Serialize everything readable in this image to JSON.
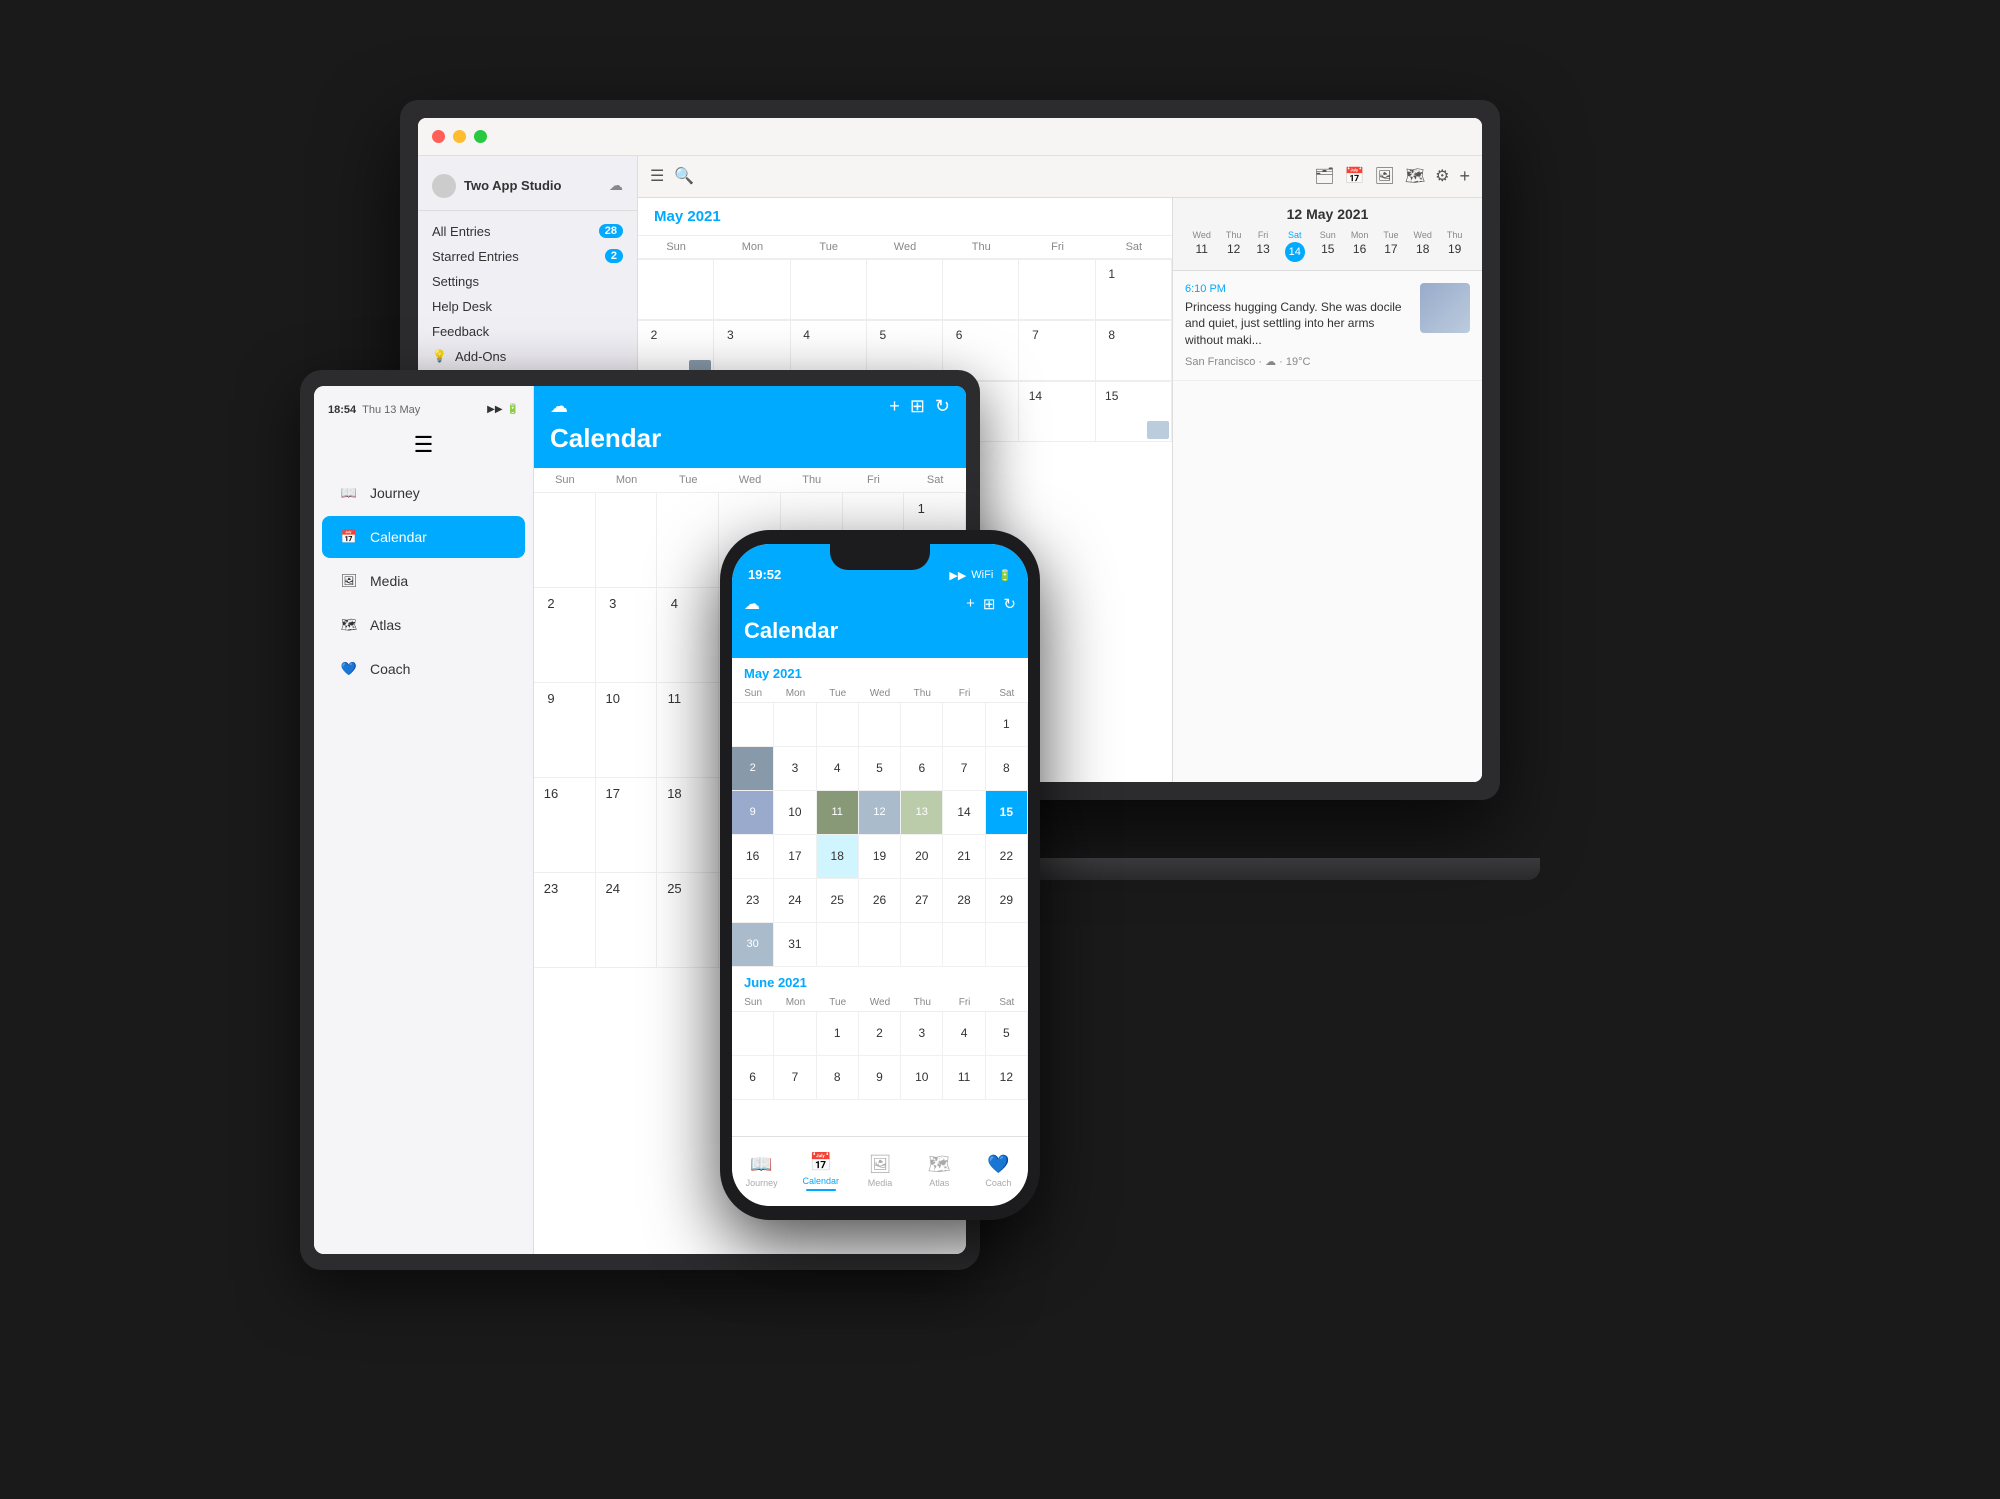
{
  "app": {
    "name": "Journey",
    "studio": "Two App Studio"
  },
  "laptop": {
    "sidebar": {
      "username": "Two App Studio",
      "items": [
        {
          "label": "All Entries",
          "badge": "28",
          "active": false
        },
        {
          "label": "Starred Entries",
          "badge": "2",
          "active": false
        },
        {
          "label": "Settings",
          "badge": null,
          "active": false
        },
        {
          "label": "Help Desk",
          "badge": null,
          "active": false
        },
        {
          "label": "Feedback",
          "badge": null,
          "active": false
        },
        {
          "label": "Add-Ons",
          "badge": null,
          "active": false
        }
      ]
    },
    "calendar": {
      "month": "May 2021",
      "days_header": [
        "Sun",
        "Mon",
        "Tue",
        "Wed",
        "Thu",
        "Fri",
        "Sat"
      ]
    },
    "right_panel": {
      "date_title": "12 May 2021",
      "week_days": [
        {
          "label": "Wed",
          "num": "11"
        },
        {
          "label": "Thu",
          "num": "12"
        },
        {
          "label": "Fri",
          "num": "13"
        },
        {
          "label": "Sat",
          "num": "14",
          "selected": true
        },
        {
          "label": "Sun",
          "num": "15"
        },
        {
          "label": "Mon",
          "num": "16"
        },
        {
          "label": "Tue",
          "num": "17"
        },
        {
          "label": "Wed",
          "num": "18"
        },
        {
          "label": "Thu",
          "num": "19"
        }
      ],
      "entry_time": "6:10 PM",
      "entry_text": "Princess hugging Candy. She was docile and quiet, just settling into her arms without maki...",
      "entry_meta": "San Francisco · ☁ · 19°C"
    }
  },
  "tablet": {
    "status_time": "18:54",
    "status_date": "Thu 13 May",
    "sidebar_items": [
      {
        "label": "Journey",
        "icon": "📖",
        "active": false
      },
      {
        "label": "Calendar",
        "icon": "📅",
        "active": true
      },
      {
        "label": "Media",
        "icon": "🖼",
        "active": false
      },
      {
        "label": "Atlas",
        "icon": "🗺",
        "active": false
      },
      {
        "label": "Coach",
        "icon": "💙",
        "active": false
      }
    ],
    "header_title": "Calendar",
    "calendar": {
      "days_header": [
        "Sun",
        "Mon",
        "Tue",
        "Wed",
        "Thu",
        "Fri",
        "Sat"
      ]
    }
  },
  "phone": {
    "status_time": "19:52",
    "header_title": "Calendar",
    "months": [
      {
        "label": "May 2021",
        "days_header": [
          "Sun",
          "Mon",
          "Tue",
          "Wed",
          "Thu",
          "Fri",
          "Sat"
        ],
        "rows": [
          [
            "",
            "",
            "",
            "",
            "",
            "",
            "1"
          ],
          [
            "2",
            "3",
            "4",
            "5",
            "6",
            "7",
            "8"
          ],
          [
            "9",
            "10",
            "11",
            "12",
            "13",
            "14",
            "15"
          ],
          [
            "16",
            "17",
            "18",
            "19",
            "20",
            "21",
            "22"
          ],
          [
            "23",
            "24",
            "25",
            "26",
            "27",
            "28",
            "29"
          ],
          [
            "30",
            "31",
            "",
            "",
            "",
            "",
            ""
          ]
        ]
      },
      {
        "label": "June 2021",
        "days_header": [
          "Sun",
          "Mon",
          "Tue",
          "Wed",
          "Thu",
          "Fri",
          "Sat"
        ],
        "rows": [
          [
            "",
            "",
            "1",
            "2",
            "3",
            "4",
            "5"
          ],
          [
            "6",
            "7",
            "8",
            "9",
            "10",
            "11",
            "12"
          ]
        ]
      }
    ],
    "tab_items": [
      {
        "label": "Journey",
        "icon": "📖",
        "active": false
      },
      {
        "label": "Calendar",
        "icon": "📅",
        "active": true
      },
      {
        "label": "Media",
        "icon": "🖼",
        "active": false
      },
      {
        "label": "Atlas",
        "icon": "🗺",
        "active": false
      },
      {
        "label": "Coach",
        "icon": "💙",
        "active": false
      }
    ]
  },
  "icons": {
    "cloud": "☁",
    "search": "🔍",
    "plus": "+",
    "grid": "⊞",
    "sync": "↻"
  }
}
